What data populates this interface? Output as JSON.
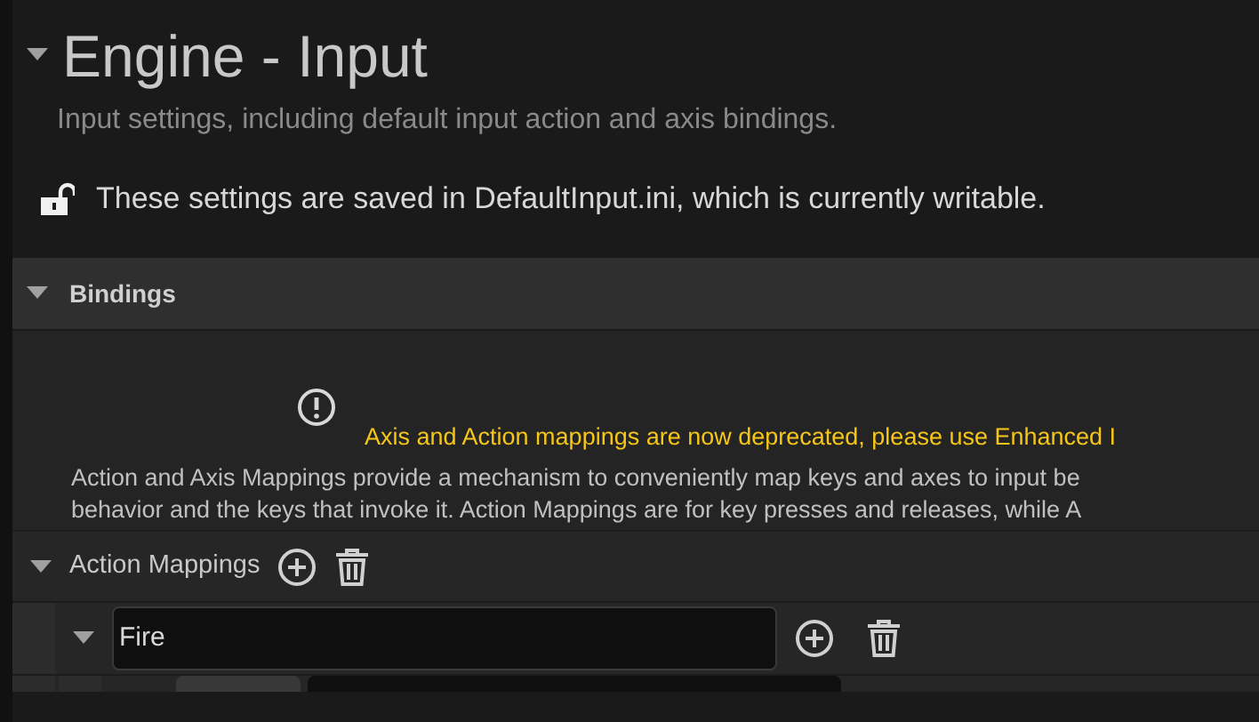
{
  "section": {
    "title": "Engine - Input",
    "expanded": true,
    "description": "Input settings, including default input action and axis bindings.",
    "config_notice": "These settings are saved in DefaultInput.ini, which is currently writable.",
    "locked": false
  },
  "bindings": {
    "title": "Bindings",
    "expanded": true,
    "warning": "Axis and Action mappings are now deprecated, please use Enhanced I",
    "description_lines": [
      "Action and Axis Mappings provide a mechanism to conveniently map keys and axes to input be",
      "behavior and the keys that invoke it. Action Mappings are for key presses and releases, while A"
    ],
    "action_mappings": {
      "label": "Action Mappings",
      "expanded": true,
      "items": [
        {
          "value": "Fire",
          "expanded": true
        }
      ]
    }
  }
}
